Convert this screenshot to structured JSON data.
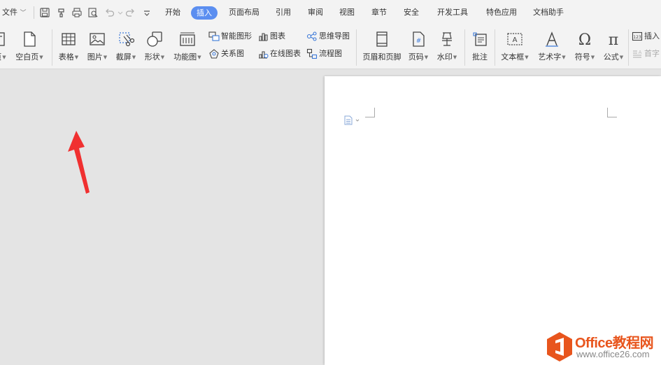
{
  "menu": {
    "file": "文件",
    "tabs": [
      "开始",
      "插入",
      "页面布局",
      "引用",
      "审阅",
      "视图",
      "章节",
      "安全",
      "开发工具",
      "特色应用",
      "文档助手"
    ],
    "active_tab": "插入"
  },
  "ribbon": {
    "cover_page_partial": "页",
    "blank_page": "空白页",
    "table": "表格",
    "picture": "图片",
    "screenshot": "截屏",
    "shapes": "形状",
    "function_chart": "功能图",
    "smart_shape": "智能图形",
    "chart": "图表",
    "mind_map": "思维导图",
    "relation_chart": "关系图",
    "online_chart": "在线图表",
    "flow_chart": "流程图",
    "header_footer": "页眉和页脚",
    "page_number": "页码",
    "watermark": "水印",
    "comment": "批注",
    "text_box": "文本框",
    "art_text": "艺术字",
    "symbol": "符号",
    "formula": "公式",
    "insert_partial": "插入",
    "first_char_partial": "首字"
  },
  "watermark": {
    "brand": "Office教程网",
    "url": "www.office26.com"
  }
}
